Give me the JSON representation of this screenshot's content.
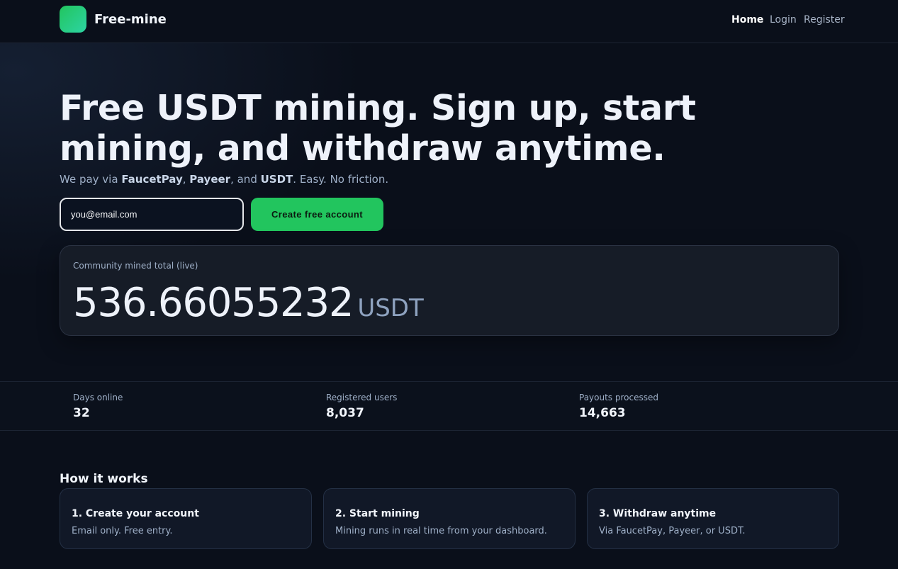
{
  "header": {
    "brand": "Free-mine",
    "nav": {
      "home": "Home",
      "login": "Login",
      "register": "Register"
    }
  },
  "hero": {
    "headline": "Free USDT mining. Sign up, start mining, and withdraw anytime.",
    "sub_prefix": "We pay via ",
    "sub_faucetpay": "FaucetPay",
    "sub_sep1": ", ",
    "sub_payeer": "Payeer",
    "sub_sep2": ", and ",
    "sub_usdt": "USDT",
    "sub_suffix": ". Easy. No friction.",
    "email_placeholder": "you@email.com",
    "cta_label": "Create free account"
  },
  "live": {
    "label": "Community mined total (live)",
    "value": "536.66055232",
    "unit": "USDT"
  },
  "stats": [
    {
      "label": "Days online",
      "value": "32"
    },
    {
      "label": "Registered users",
      "value": "8,037"
    },
    {
      "label": "Payouts processed",
      "value": "14,663"
    }
  ],
  "how": {
    "title": "How it works",
    "steps": [
      {
        "title": "1. Create your account",
        "desc": "Email only. Free entry."
      },
      {
        "title": "2. Start mining",
        "desc": "Mining runs in real time from your dashboard."
      },
      {
        "title": "3. Withdraw anytime",
        "desc": "Via FaucetPay, Payeer, or USDT."
      }
    ]
  },
  "colors": {
    "background": "#0a0f1a",
    "accent": "#22c55e",
    "card": "#161c27",
    "muted_text": "#9fb0c8"
  },
  "icons": {
    "logo": "gradient-square-logo-icon"
  }
}
